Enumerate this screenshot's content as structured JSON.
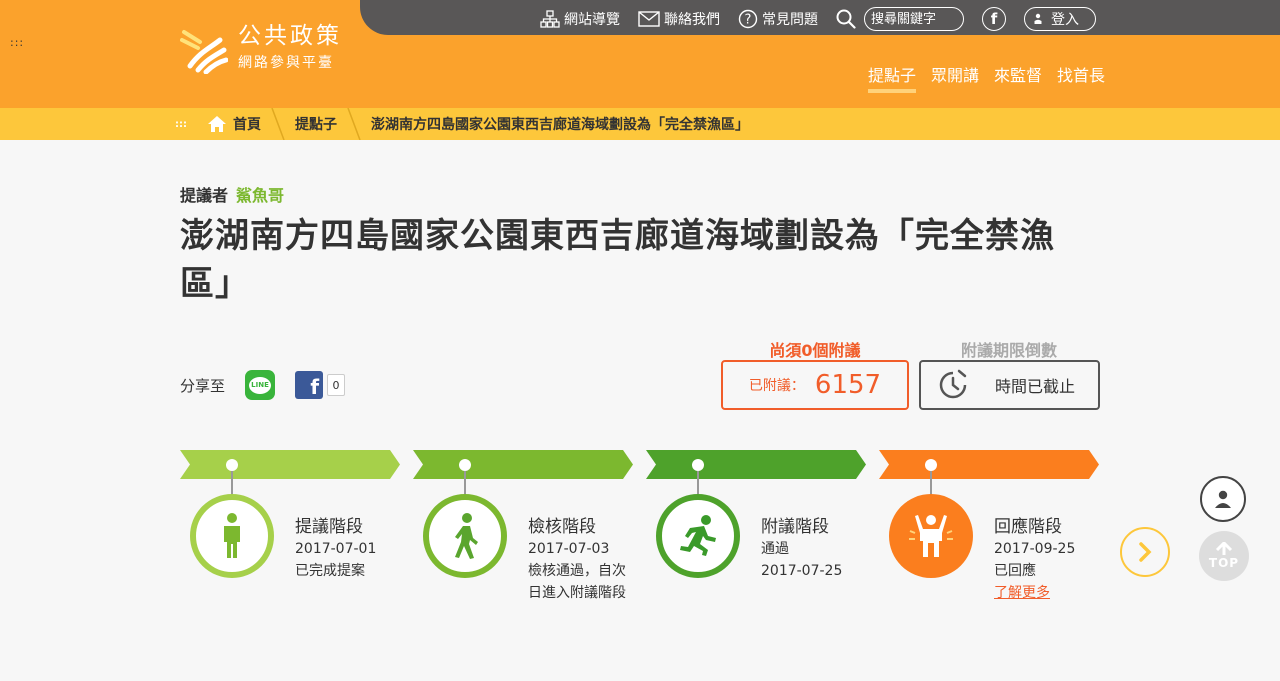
{
  "site": {
    "name": "公共政策",
    "subtitle": "網路參與平臺"
  },
  "utilities": {
    "sitemap": "網站導覽",
    "contact": "聯絡我們",
    "faq": "常見問題",
    "search_placeholder": "搜尋關鍵字",
    "facebook": "f",
    "login": "登入"
  },
  "nav": [
    {
      "label": "提點子",
      "active": true
    },
    {
      "label": "眾開講",
      "active": false
    },
    {
      "label": "來監督",
      "active": false
    },
    {
      "label": "找首長",
      "active": false
    }
  ],
  "breadcrumb": {
    "home": "首頁",
    "section": "提點子",
    "current": "澎湖南方四島國家公園東西吉廊道海域劃設為「完全禁漁區」"
  },
  "proposal": {
    "proposer_label": "提議者",
    "proposer_name": "鯊魚哥",
    "title": "澎湖南方四島國家公園東西吉廊道海域劃設為「完全禁漁區」"
  },
  "share": {
    "label": "分享至",
    "line": "LINE",
    "fb_letter": "f",
    "fb_count": "0"
  },
  "support": {
    "need_label": "尚須0個附議",
    "seconded_label": "已附議：",
    "seconded_count": "6157",
    "countdown_label": "附議期限倒數",
    "countdown_status": "時間已截止"
  },
  "stages": [
    {
      "name": "提議階段",
      "line1": "2017-07-01",
      "line2": "已完成提案",
      "line3": "",
      "link": ""
    },
    {
      "name": "檢核階段",
      "line1": "2017-07-03",
      "line2": "檢核通過，自次",
      "line3": "日進入附議階段",
      "link": ""
    },
    {
      "name": "附議階段",
      "line1": "通過",
      "line2": "2017-07-25",
      "line3": "",
      "link": ""
    },
    {
      "name": "回應階段",
      "line1": "2017-09-25",
      "line2": "已回應",
      "line3": "",
      "link": "了解更多"
    }
  ],
  "float": {
    "top_label": "TOP"
  },
  "colors": {
    "header": "#fba22c",
    "topbar": "#595757",
    "breadcrumb": "#fdc73b",
    "stage1": "#a6d04a",
    "stage2": "#7cb82f",
    "stage3": "#4ea22b",
    "stage4": "#fb7e1e",
    "accent_red": "#f15d2a"
  }
}
